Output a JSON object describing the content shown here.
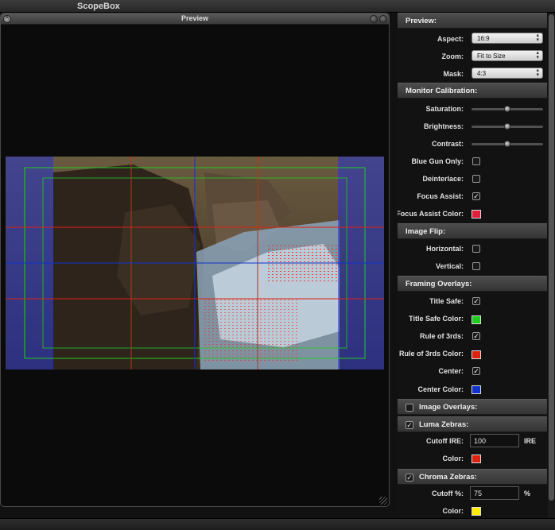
{
  "app": {
    "title": "ScopeBox"
  },
  "preview": {
    "title": "Preview"
  },
  "sections": {
    "preview": "Preview:",
    "monitor_calibration": "Monitor Calibration:",
    "image_flip": "Image Flip:",
    "framing_overlays": "Framing Overlays:",
    "image_overlays": "Image Overlays:",
    "luma_zebras": "Luma Zebras:",
    "chroma_zebras": "Chroma Zebras:"
  },
  "preview_settings": {
    "aspect_label": "Aspect:",
    "aspect_value": "16:9",
    "zoom_label": "Zoom:",
    "zoom_value": "Fit to Size",
    "mask_label": "Mask:",
    "mask_value": "4:3"
  },
  "calibration": {
    "saturation_label": "Saturation:",
    "saturation_value": 0.5,
    "brightness_label": "Brightness:",
    "brightness_value": 0.5,
    "contrast_label": "Contrast:",
    "contrast_value": 0.5,
    "blue_gun_label": "Blue Gun Only:",
    "blue_gun_checked": false,
    "deinterlace_label": "Deinterlace:",
    "deinterlace_checked": false,
    "focus_assist_label": "Focus Assist:",
    "focus_assist_checked": true,
    "focus_assist_color_label": "Focus Assist Color:",
    "focus_assist_color": "#e0203a"
  },
  "flip": {
    "horizontal_label": "Horizontal:",
    "horizontal_checked": false,
    "vertical_label": "Vertical:",
    "vertical_checked": false
  },
  "framing": {
    "title_safe_label": "Title Safe:",
    "title_safe_checked": true,
    "title_safe_color_label": "Title Safe Color:",
    "title_safe_color": "#22cc22",
    "rule_of_thirds_label": "Rule of 3rds:",
    "rule_of_thirds_checked": true,
    "rule_of_thirds_color_label": "Rule of 3rds Color:",
    "rule_of_thirds_color": "#dd2211",
    "center_label": "Center:",
    "center_checked": true,
    "center_color_label": "Center Color:",
    "center_color": "#1133cc"
  },
  "image_overlays": {
    "checked": false
  },
  "luma": {
    "checked": true,
    "cutoff_label": "Cutoff IRE:",
    "cutoff_value": "100",
    "unit": "IRE",
    "color_label": "Color:",
    "color": "#dd2211"
  },
  "chroma": {
    "checked": true,
    "cutoff_label": "Cutoff %:",
    "cutoff_value": "75",
    "unit": "%",
    "color_label": "Color:",
    "color": "#ffee00"
  },
  "icons": {
    "popup_arrows": "updown-arrows-icon",
    "checkmark": "✓"
  }
}
